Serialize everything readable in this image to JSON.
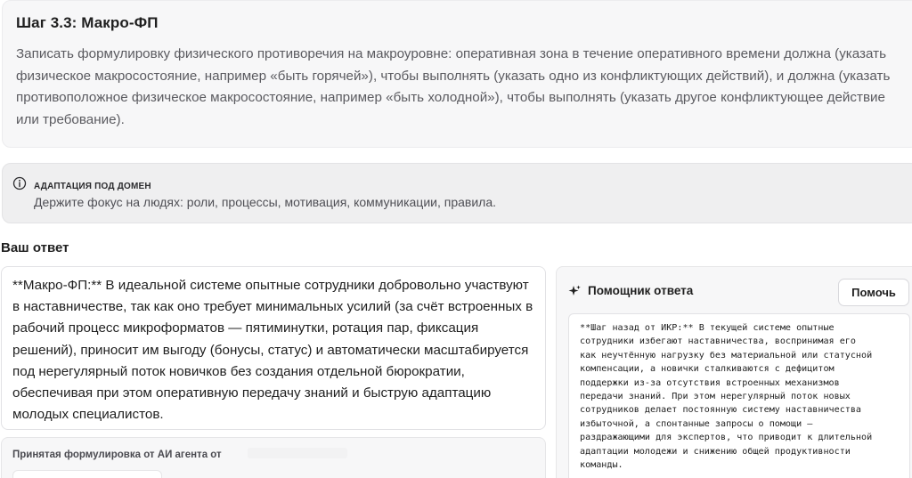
{
  "step": {
    "title": "Шаг 3.3: Макро-ФП",
    "description": "Записать формулировку физического противоречия на макроуровне: оперативная зона в течение оперативного времени должна (указать физическое макросостояние, например «быть горячей»), чтобы выполнять (указать одно из конфликтующих действий), и должна (указать противоположное физическое макросостояние, например «быть холодной»), чтобы выполнять (указать другое конфликтующее действие или требование)."
  },
  "domain": {
    "icon": "info-icon",
    "label": "АДАПТАЦИЯ ПОД ДОМЕН",
    "text": "Держите фокус на людях: роли, процессы, мотивация, коммуникации, правила."
  },
  "answer": {
    "heading": "Ваш ответ",
    "text": "**Макро-ФП:** В идеальной системе опытные сотрудники добровольно участвуют в наставничестве, так как оно требует минимальных усилий (за счёт встроенных в рабочий процесс микроформатов — пятиминутки, ротация пар, фиксация решений), приносит им выгоду (бонусы, статус) и автоматически масштабируется под нерегулярный поток новичков без создания отдельной бюрократии, обеспечивая при этом оперативную передачу знаний и быструю адаптацию молодых специалистов."
  },
  "accepted": {
    "label": "Принятая формулировка от АИ агента от"
  },
  "assistant": {
    "icon": "sparkle-icon",
    "title": "Помощник ответа",
    "help_label": "Помочь",
    "output": "**Шаг назад от ИКР:** В текущей системе опытные\nсотрудники избегают наставничества, воспринимая его\nкак неучтённую нагрузку без материальной или статусной\nкомпенсации, а новички сталкиваются с дефицитом\nподдержки из-за отсутствия встроенных механизмов\nпередачи знаний. При этом нерегулярный поток новых\nсотрудников делает постоянную систему наставничества\nизбыточной, а спонтанные запросы о помощи —\nраздражающими для экспертов, что приводит к длительной\nадаптации молодежи и снижению общей продуктивности\nкоманды."
  }
}
